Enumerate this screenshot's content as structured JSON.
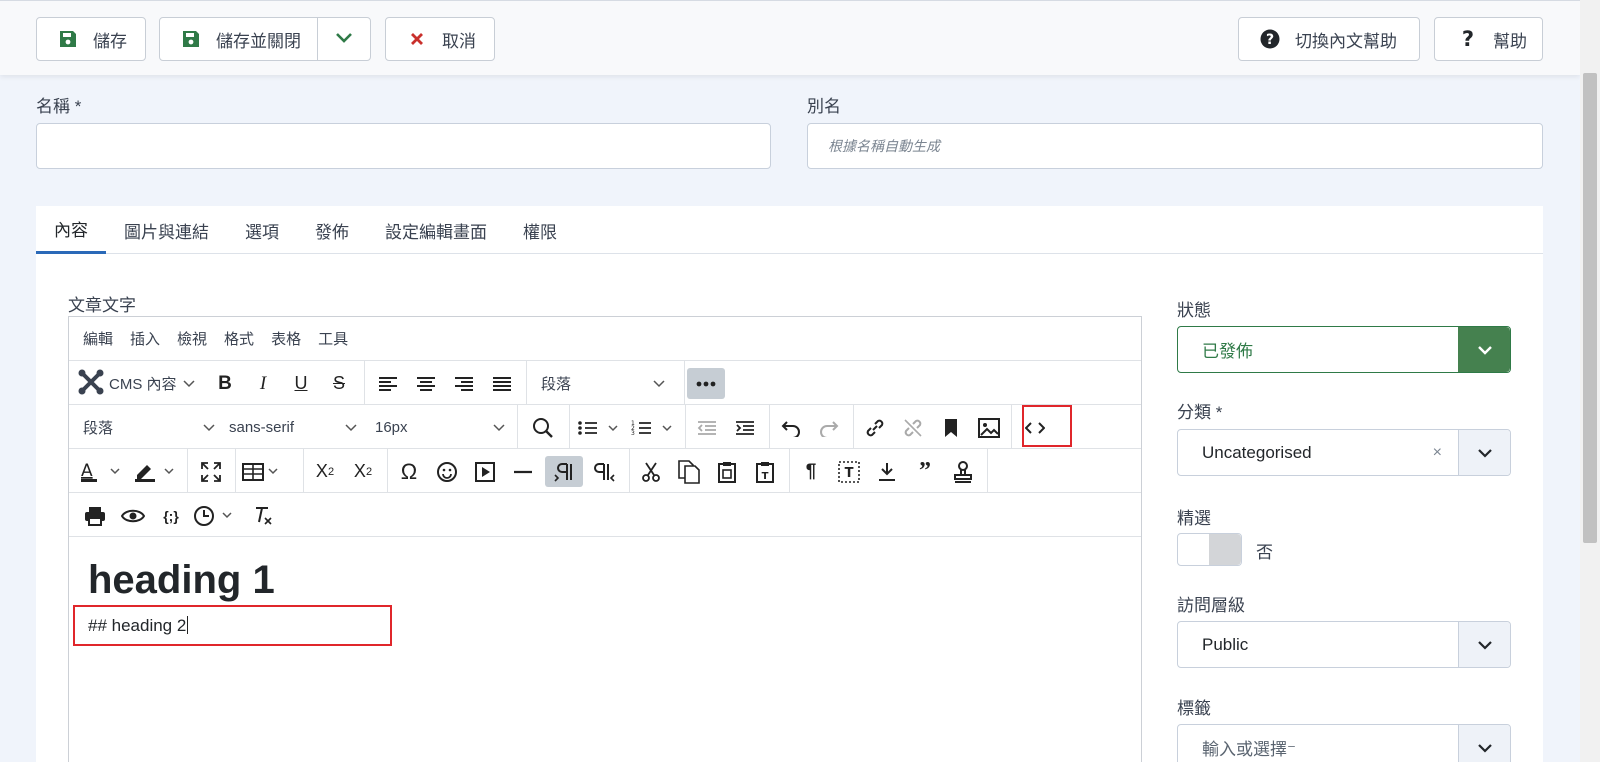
{
  "toolbar": {
    "save": "儲存",
    "save_close": "儲存並關閉",
    "cancel": "取消",
    "context_help": "切換內文幫助",
    "help": "幫助"
  },
  "form": {
    "title_label": "名稱 *",
    "title_value": "",
    "alias_label": "別名",
    "alias_placeholder": "根據名稱自動生成"
  },
  "tabs": [
    "內容",
    "圖片與連結",
    "選項",
    "發佈",
    "設定編輯畫面",
    "權限"
  ],
  "editor": {
    "label": "文章文字",
    "menu": [
      "編輯",
      "插入",
      "檢視",
      "格式",
      "表格",
      "工具"
    ],
    "cms_content": "CMS 內容",
    "block_format_1": "段落",
    "block_format_2": "段落",
    "font_family": "sans-serif",
    "font_size": "16px",
    "heading1": "heading 1",
    "paragraph": "## heading 2"
  },
  "sidebar": {
    "status_label": "狀態",
    "status_value": "已發佈",
    "category_label": "分類 *",
    "category_value": "Uncategorised",
    "category_clear": "×",
    "featured_label": "精選",
    "featured_value": "否",
    "access_label": "訪問層級",
    "access_value": "Public",
    "tags_label": "標籤",
    "tags_placeholder": "輸入或選擇⁻"
  },
  "colors": {
    "save_icon": "#2f7a47",
    "cancel_icon": "#c9302c",
    "status_green": "#45814f",
    "tab_active": "#2a69b8",
    "highlight_red": "#e0262b"
  }
}
